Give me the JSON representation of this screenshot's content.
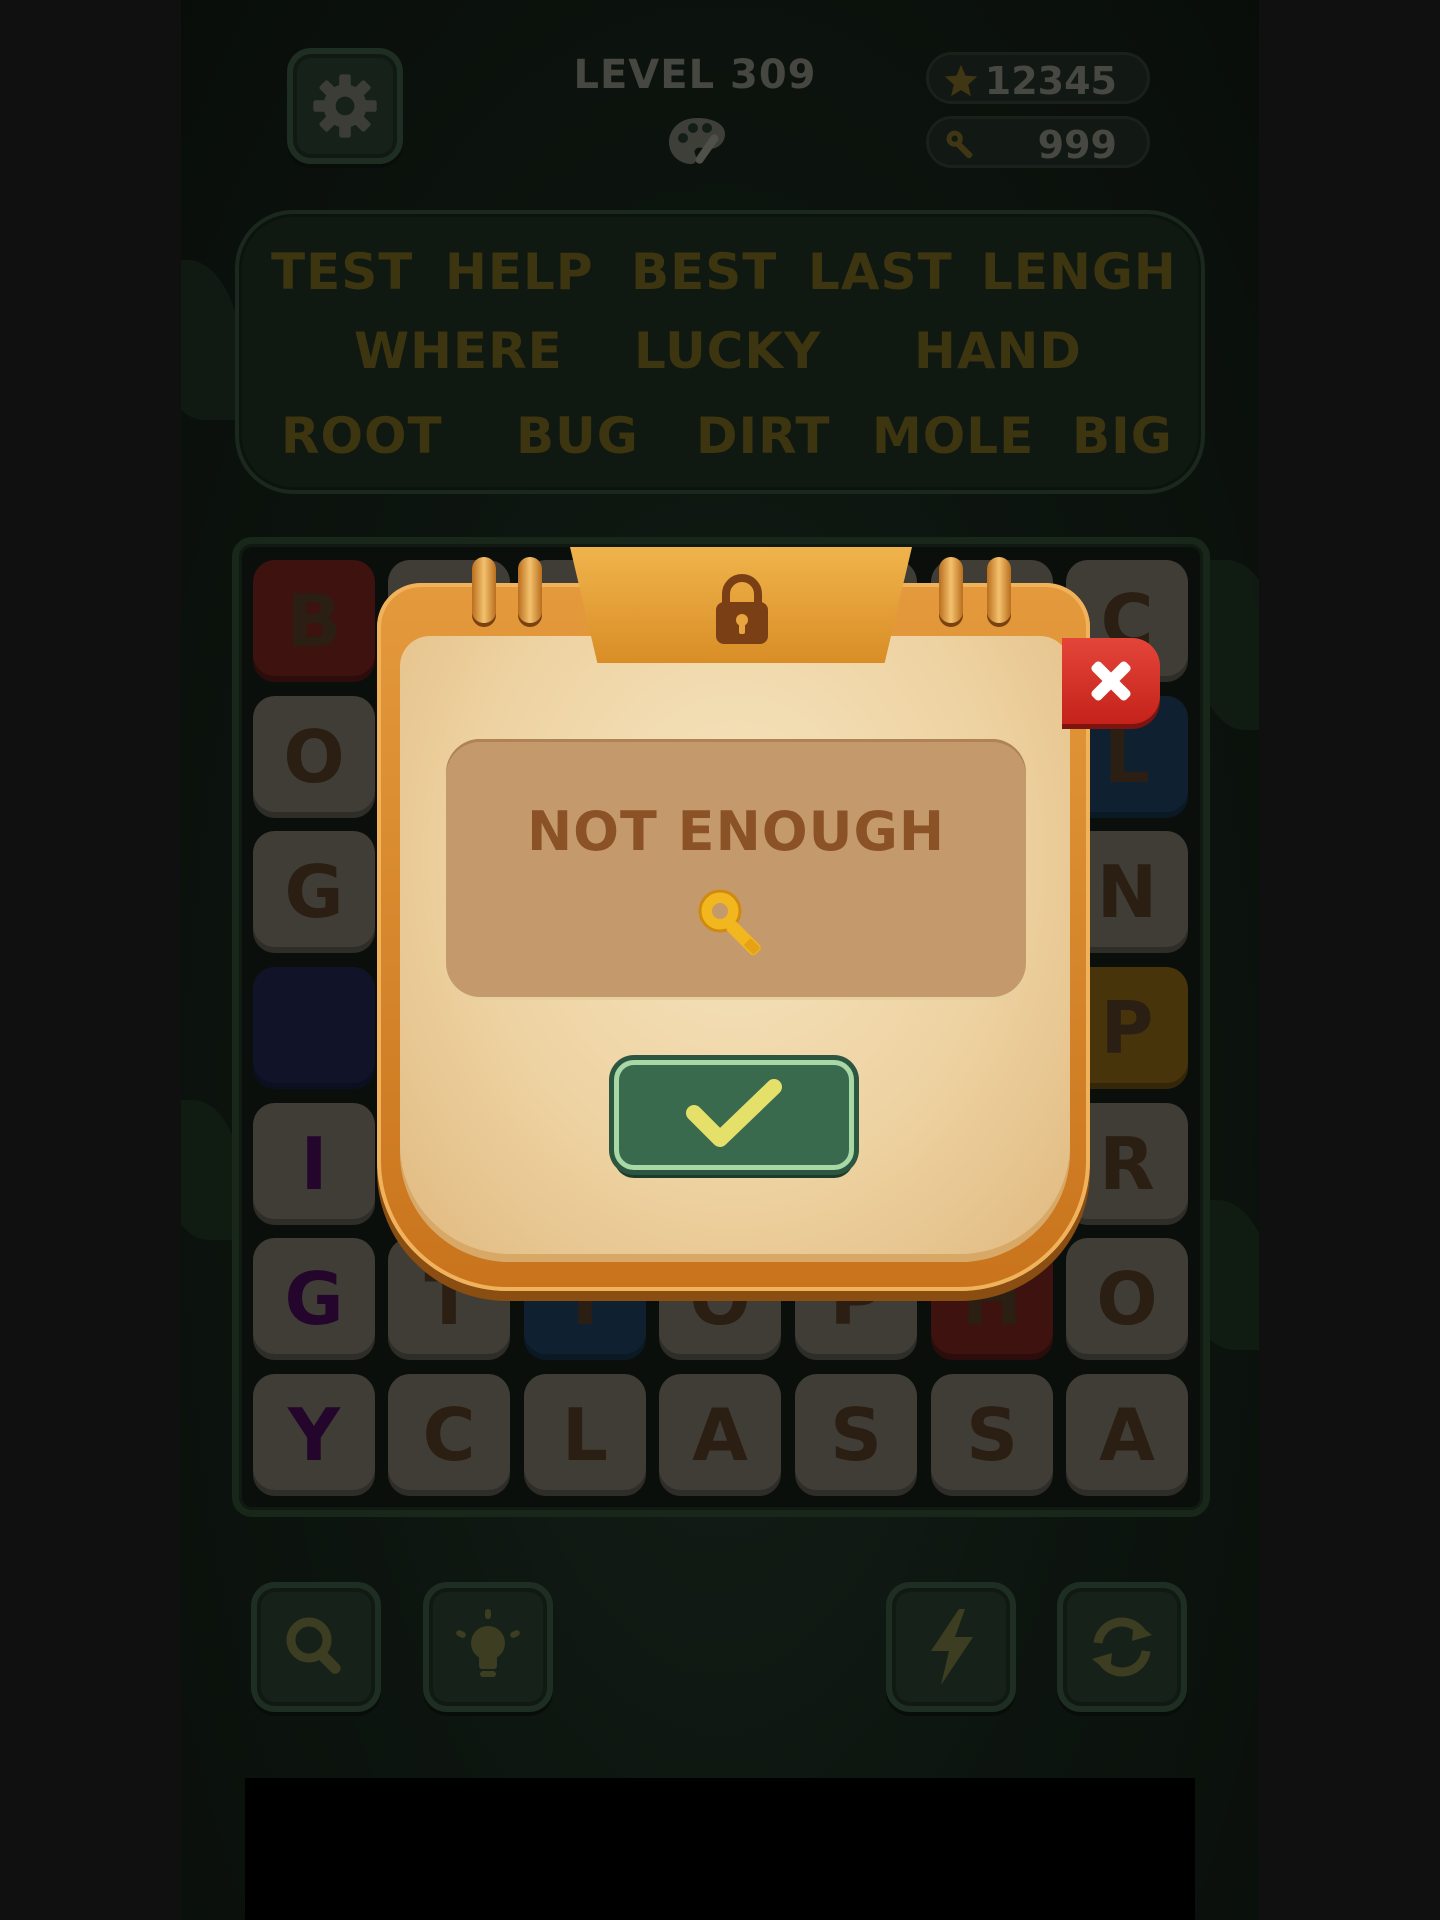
{
  "header": {
    "level_label": "LEVEL 309",
    "stars_value": "12345",
    "keys_value": "999"
  },
  "word_list": [
    [
      "TEST",
      "HELP",
      "BEST",
      "LAST",
      "LENGH"
    ],
    [
      "WHERE",
      "LUCKY",
      "HAND"
    ],
    [
      "ROOT",
      "BUG",
      "DIRT",
      "MOLE",
      "BIG"
    ]
  ],
  "grid": {
    "rows": [
      [
        "B",
        "",
        "",
        "",
        "",
        "",
        "C"
      ],
      [
        "O",
        "",
        "",
        "",
        "",
        "",
        "L"
      ],
      [
        "G",
        "",
        "",
        "",
        "",
        "",
        "N"
      ],
      [
        "",
        "",
        "",
        "",
        "",
        "",
        "P"
      ],
      [
        "I",
        "",
        "",
        "",
        "",
        "",
        "R"
      ],
      [
        "G",
        "T",
        "Y",
        "O",
        "P",
        "H",
        "O"
      ],
      [
        "Y",
        "C",
        "L",
        "A",
        "S",
        "S",
        "A"
      ]
    ]
  },
  "popup": {
    "message": "NOT ENOUGH",
    "currency_icon": "key-icon"
  },
  "colors": {
    "tile_default": "#6e6a5e",
    "tile_red": "#6a1f1a",
    "tile_blue": "#1b3a55",
    "tile_navy": "#1e2348",
    "tile_yellow": "#7a5a14",
    "letter_purple": "#3e0a4a",
    "confirm_green": "#3a6a4e",
    "close_red": "#d4302a"
  }
}
